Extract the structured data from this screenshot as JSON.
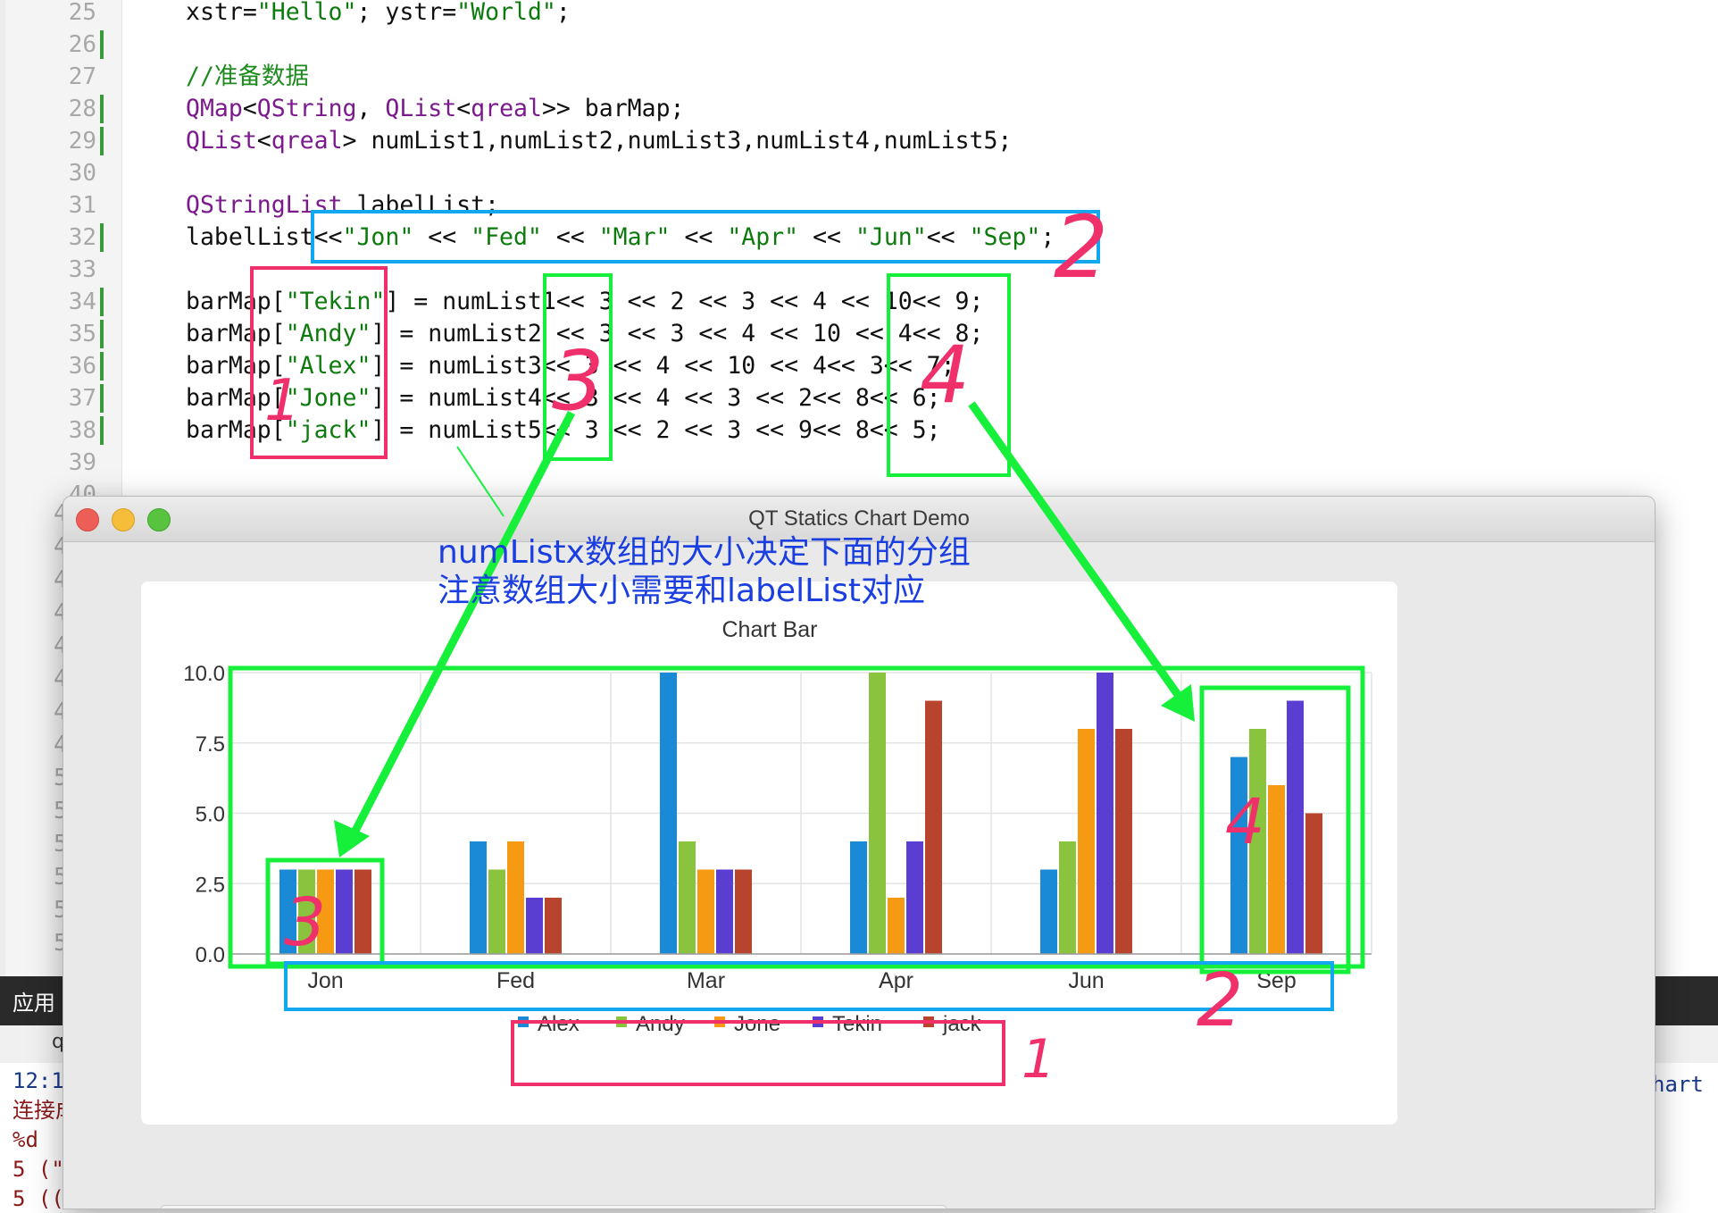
{
  "editor": {
    "lines": [
      {
        "num": "25",
        "changed": false,
        "tokens": [
          {
            "t": "xstr=",
            "c": "plain"
          },
          {
            "t": "\"Hello\"",
            "c": "str"
          },
          {
            "t": "; ystr=",
            "c": "plain"
          },
          {
            "t": "\"World\"",
            "c": "str"
          },
          {
            "t": ";",
            "c": "plain"
          }
        ]
      },
      {
        "num": "26",
        "changed": true,
        "tokens": []
      },
      {
        "num": "27",
        "changed": false,
        "tokens": [
          {
            "t": "//准备数据",
            "c": "cmt"
          }
        ]
      },
      {
        "num": "28",
        "changed": true,
        "tokens": [
          {
            "t": "QMap",
            "c": "kw"
          },
          {
            "t": "<",
            "c": "plain"
          },
          {
            "t": "QString",
            "c": "kw"
          },
          {
            "t": ", ",
            "c": "plain"
          },
          {
            "t": "QList",
            "c": "kw"
          },
          {
            "t": "<",
            "c": "plain"
          },
          {
            "t": "qreal",
            "c": "kw"
          },
          {
            "t": ">> barMap;",
            "c": "plain"
          }
        ]
      },
      {
        "num": "29",
        "changed": true,
        "tokens": [
          {
            "t": "QList",
            "c": "kw"
          },
          {
            "t": "<",
            "c": "plain"
          },
          {
            "t": "qreal",
            "c": "kw"
          },
          {
            "t": "> numList1,numList2,numList3,numList4,numList5;",
            "c": "plain"
          }
        ]
      },
      {
        "num": "30",
        "changed": false,
        "tokens": []
      },
      {
        "num": "31",
        "changed": false,
        "tokens": [
          {
            "t": "QStringList",
            "c": "kw"
          },
          {
            "t": " labelList;",
            "c": "plain"
          }
        ]
      },
      {
        "num": "32",
        "changed": true,
        "tokens": [
          {
            "t": "labelList<<",
            "c": "plain"
          },
          {
            "t": "\"Jon\"",
            "c": "str"
          },
          {
            "t": " << ",
            "c": "plain"
          },
          {
            "t": "\"Fed\"",
            "c": "str"
          },
          {
            "t": " << ",
            "c": "plain"
          },
          {
            "t": "\"Mar\"",
            "c": "str"
          },
          {
            "t": " << ",
            "c": "plain"
          },
          {
            "t": "\"Apr\"",
            "c": "str"
          },
          {
            "t": " << ",
            "c": "plain"
          },
          {
            "t": "\"Jun\"",
            "c": "str"
          },
          {
            "t": "<< ",
            "c": "plain"
          },
          {
            "t": "\"Sep\"",
            "c": "str"
          },
          {
            "t": ";",
            "c": "plain"
          }
        ]
      },
      {
        "num": "33",
        "changed": false,
        "tokens": []
      },
      {
        "num": "34",
        "changed": true,
        "tokens": [
          {
            "t": "barMap[",
            "c": "plain"
          },
          {
            "t": "\"Tekin\"",
            "c": "str"
          },
          {
            "t": "] = numList1<< 3 << 2 << 3 << 4 << 10<< 9;",
            "c": "plain"
          }
        ]
      },
      {
        "num": "35",
        "changed": true,
        "tokens": [
          {
            "t": "barMap[",
            "c": "plain"
          },
          {
            "t": "\"Andy\"",
            "c": "str"
          },
          {
            "t": "] = numList2 << 3 << 3 << 4 << 10 << 4<< 8;",
            "c": "plain"
          }
        ]
      },
      {
        "num": "36",
        "changed": true,
        "tokens": [
          {
            "t": "barMap[",
            "c": "plain"
          },
          {
            "t": "\"Alex\"",
            "c": "str"
          },
          {
            "t": "] = numList3<< 3 << 4 << 10 << 4<< 3<< 7;",
            "c": "plain"
          }
        ]
      },
      {
        "num": "37",
        "changed": true,
        "tokens": [
          {
            "t": "barMap[",
            "c": "plain"
          },
          {
            "t": "\"Jone\"",
            "c": "str"
          },
          {
            "t": "] = numList4<< 3 << 4 << 3 << 2<< 8<< 6;",
            "c": "plain"
          }
        ]
      },
      {
        "num": "38",
        "changed": true,
        "tokens": [
          {
            "t": "barMap[",
            "c": "plain"
          },
          {
            "t": "\"jack\"",
            "c": "str"
          },
          {
            "t": "] = numList5<< 3 << 2 << 3 << 9<< 8<< 5;",
            "c": "plain"
          }
        ]
      },
      {
        "num": "39",
        "changed": false,
        "tokens": []
      },
      {
        "num": "40",
        "changed": false,
        "tokens": []
      }
    ],
    "gutter_extra_digits": [
      "4",
      "4",
      "4",
      "4",
      "4",
      "4",
      "4",
      "4",
      "5",
      "5",
      "5",
      "5",
      "5",
      "5"
    ]
  },
  "bottom_panel": {
    "label": "应用",
    "tab_text": "q",
    "output_lines": [
      {
        "text": "12:1",
        "color": "#1a3a8a"
      },
      {
        "text": "连接成",
        "color": "#8a1a1a"
      },
      {
        "text": "%d",
        "color": "#8a1a1a"
      },
      {
        "text": "5 (\"",
        "color": "#8a1a1a"
      },
      {
        "text": "5 ((",
        "color": "#8a1a1a"
      }
    ],
    "right_text": "hart"
  },
  "window": {
    "title": "QT Statics Chart Demo"
  },
  "chart_data": {
    "type": "bar",
    "title": "Chart Bar",
    "categories": [
      "Jon",
      "Fed",
      "Mar",
      "Apr",
      "Jun",
      "Sep"
    ],
    "ylim": [
      0,
      10
    ],
    "yticks": [
      "10.0",
      "7.5",
      "5.0",
      "2.5",
      "0.0"
    ],
    "ytick_values": [
      10,
      7.5,
      5,
      2.5,
      0
    ],
    "grid": true,
    "legend_position": "bottom",
    "series": [
      {
        "name": "Alex",
        "color": "#1a8ad6",
        "values": [
          3,
          4,
          10,
          4,
          3,
          7
        ]
      },
      {
        "name": "Andy",
        "color": "#8ac33e",
        "values": [
          3,
          3,
          4,
          10,
          4,
          8
        ]
      },
      {
        "name": "Jone",
        "color": "#f59a12",
        "values": [
          3,
          4,
          3,
          2,
          8,
          6
        ]
      },
      {
        "name": "Tekin",
        "color": "#5a3ed2",
        "values": [
          3,
          2,
          3,
          4,
          10,
          9
        ]
      },
      {
        "name": "jack",
        "color": "#b8442e",
        "values": [
          3,
          2,
          3,
          9,
          8,
          5
        ]
      }
    ]
  },
  "annotations": {
    "note_line1": "numListx数组的大小决定下面的分组",
    "note_line2": "注意数组大小需要和labelList对应",
    "marks": [
      "1",
      "2",
      "3",
      "4",
      "3",
      "4",
      "2",
      "1"
    ],
    "colors": {
      "pink": "#f0306a",
      "blue": "#12a8f0",
      "green": "#16f03a"
    }
  }
}
